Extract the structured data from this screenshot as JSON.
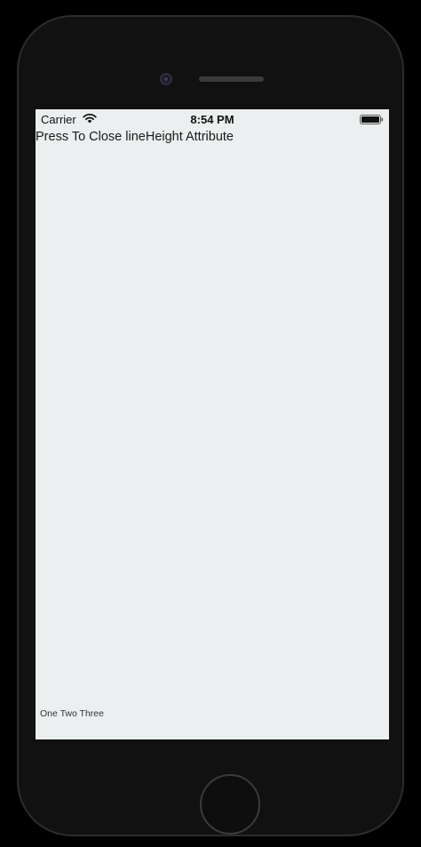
{
  "status_bar": {
    "carrier": "Carrier",
    "time": "8:54 PM",
    "wifi_icon": "wifi-icon",
    "battery_icon": "battery-full-icon"
  },
  "content": {
    "close_label": "Press To Close lineHeight Attribute",
    "footer_text": "One Two Three"
  },
  "colors": {
    "screen_background": "#ebeff0",
    "device_body": "#111111"
  }
}
